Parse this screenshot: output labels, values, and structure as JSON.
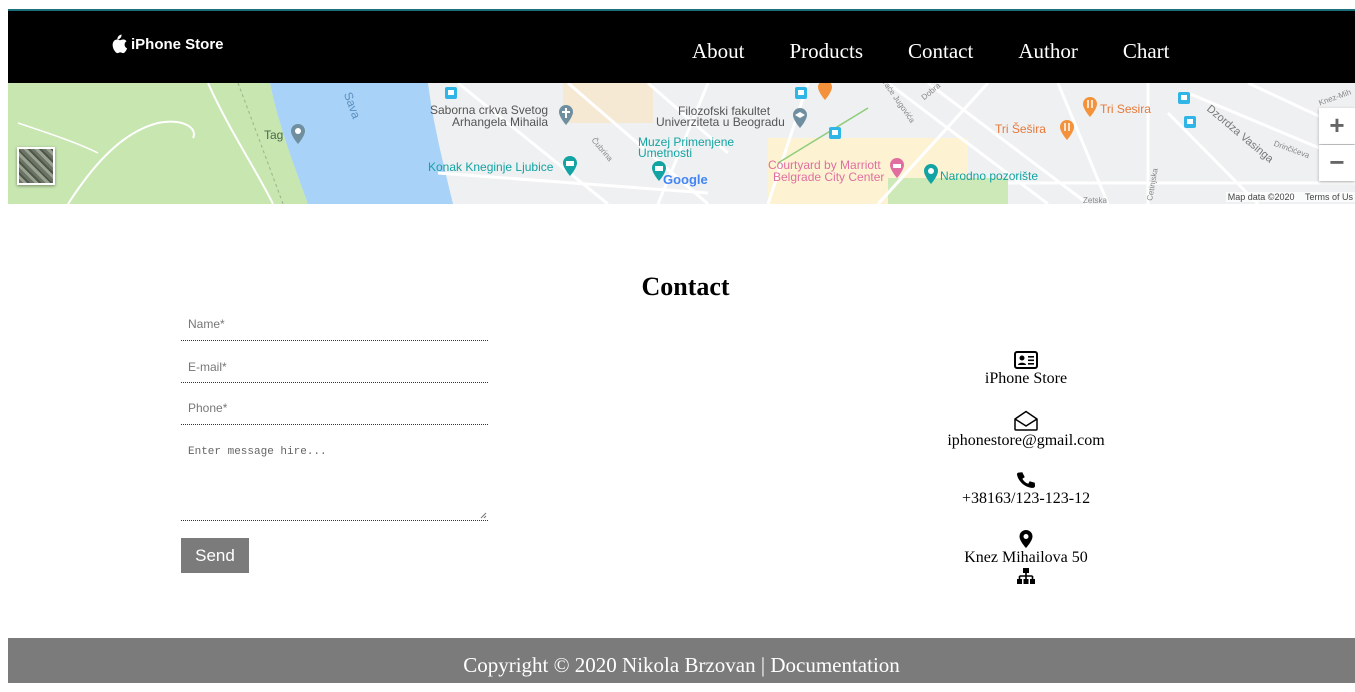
{
  "nav": {
    "brand": "iPhone Store",
    "links": [
      "About",
      "Products",
      "Contact",
      "Author",
      "Chart"
    ]
  },
  "map": {
    "labels": {
      "sava": "Sava",
      "tag": "Tag",
      "saborna1": "Saborna crkva Svetog",
      "saborna2": "Arhangela Mihaila",
      "konak": "Konak Kneginje Ljubice",
      "filozofski1": "Filozofski fakultet",
      "filozofski2": "Univerziteta u Beogradu",
      "muzej1": "Muzej Primenjene",
      "muzej2": "Umetnosti",
      "courtyard1": "Courtyard by Marriott",
      "courtyard2": "Belgrade City Center",
      "narodno": "Narodno pozorište",
      "trisesira": "Tri Šešira",
      "trisesira2": "Tri Sesira",
      "dzordza": "Dzordza Vasinga",
      "zetska": "Zetska",
      "cetinjska": "Cetinjska",
      "drinciceva": "Drinčićeva",
      "knez": "Knez-Mih",
      "brace": "Braće Jugovića",
      "dobra": "Dobra",
      "cubrina": "Čubrina",
      "google": "Google"
    },
    "zoom_in": "+",
    "zoom_out": "−",
    "credit_data": "Map data ©2020",
    "credit_terms": "Terms of Us",
    "colors": {
      "water": "#a8d2f7",
      "park": "#c7e6b0",
      "poi_teal": "#13a3a3",
      "poi_orange": "#f3923a",
      "transit": "#2fb6e6"
    }
  },
  "contact": {
    "title": "Contact",
    "name_placeholder": "Name*",
    "email_placeholder": "E-mail*",
    "phone_placeholder": "Phone*",
    "message_placeholder": "Enter message hire...",
    "send_label": "Send"
  },
  "info": {
    "store": "iPhone Store",
    "email": "iphonestore@gmail.com",
    "phone": "+38163/123-123-12",
    "address": "Knez Mihailova 50",
    "icons": [
      "id-card-icon",
      "envelope-icon",
      "phone-icon",
      "map-pin-icon",
      "sitemap-icon"
    ]
  },
  "footer": {
    "copyright": "Copyright © 2020 Nikola Brzovan",
    "separator": " | ",
    "doc_link": "Documentation"
  }
}
